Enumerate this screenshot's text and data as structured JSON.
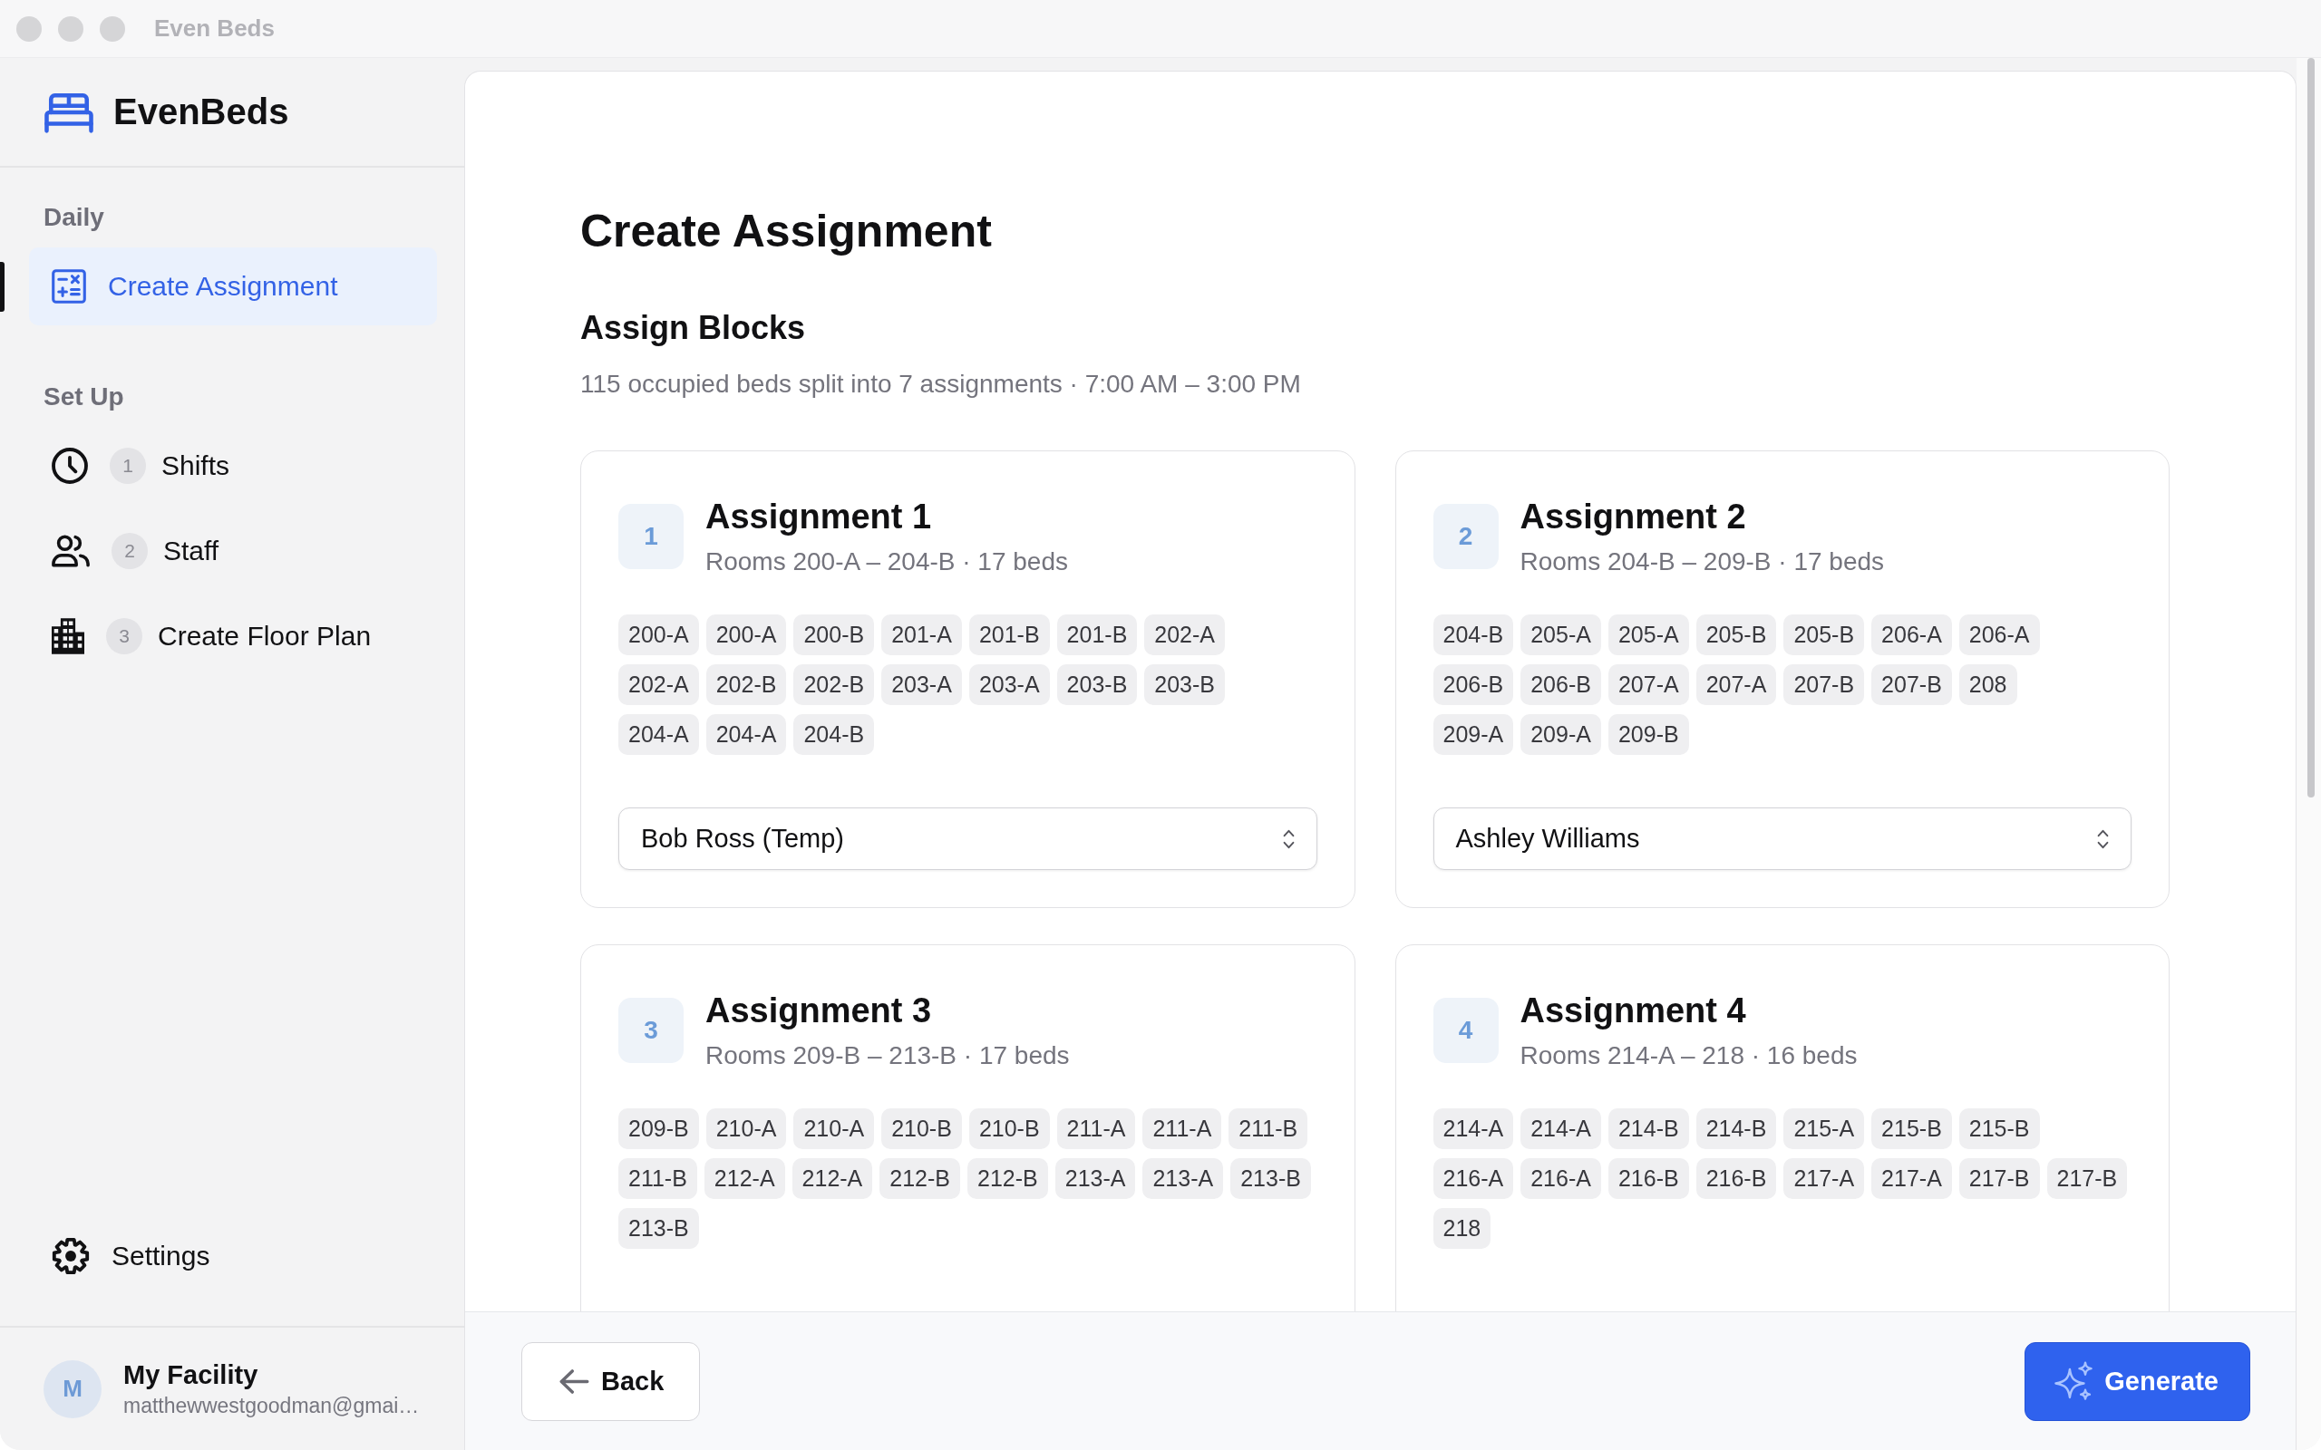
{
  "window": {
    "title": "Even Beds"
  },
  "sidebar": {
    "brand": "EvenBeds",
    "sections": [
      {
        "label": "Daily",
        "items": [
          {
            "label": "Create Assignment",
            "selected": true
          }
        ]
      },
      {
        "label": "Set Up",
        "items": [
          {
            "step": "1",
            "label": "Shifts",
            "selected": false
          },
          {
            "step": "2",
            "label": "Staff",
            "selected": false
          },
          {
            "step": "3",
            "label": "Create Floor Plan",
            "selected": false
          }
        ]
      }
    ],
    "settings": {
      "label": "Settings"
    },
    "account": {
      "avatar": "M",
      "name": "My Facility",
      "email": "matthewwestgoodman@gmai…"
    }
  },
  "page": {
    "title": "Create Assignment",
    "section_title": "Assign Blocks",
    "summary": "115 occupied beds split into 7 assignments · 7:00 AM – 3:00 PM"
  },
  "assignments": [
    {
      "number": "1",
      "title": "Assignment 1",
      "range": "Rooms 200-A – 204-B · 17 beds",
      "bed_rows": [
        [
          "200-A",
          "200-A",
          "200-B",
          "201-A",
          "201-B",
          "201-B",
          "202-A"
        ],
        [
          "202-A",
          "202-B",
          "202-B",
          "203-A",
          "203-A",
          "203-B",
          "203-B"
        ],
        [
          "204-A",
          "204-A",
          "204-B"
        ]
      ],
      "assignee": "Bob Ross (Temp)"
    },
    {
      "number": "2",
      "title": "Assignment 2",
      "range": "Rooms 204-B – 209-B · 17 beds",
      "bed_rows": [
        [
          "204-B",
          "205-A",
          "205-A",
          "205-B",
          "205-B",
          "206-A",
          "206-A"
        ],
        [
          "206-B",
          "206-B",
          "207-A",
          "207-A",
          "207-B",
          "207-B",
          "208"
        ],
        [
          "209-A",
          "209-A",
          "209-B"
        ]
      ],
      "assignee": "Ashley Williams"
    },
    {
      "number": "3",
      "title": "Assignment 3",
      "range": "Rooms 209-B – 213-B · 17 beds",
      "bed_rows": [
        [
          "209-B",
          "210-A",
          "210-A",
          "210-B",
          "210-B",
          "211-A",
          "211-A",
          "211-B"
        ],
        [
          "211-B",
          "212-A",
          "212-A",
          "212-B",
          "212-B",
          "213-A",
          "213-A",
          "213-B"
        ],
        [
          "213-B"
        ]
      ]
    },
    {
      "number": "4",
      "title": "Assignment 4",
      "range": "Rooms 214-A – 218 · 16 beds",
      "bed_rows": [
        [
          "214-A",
          "214-A",
          "214-B",
          "214-B",
          "215-A",
          "215-B",
          "215-B"
        ],
        [
          "216-A",
          "216-A",
          "216-B",
          "216-B",
          "217-A",
          "217-A",
          "217-B",
          "217-B"
        ],
        [
          "218"
        ]
      ]
    }
  ],
  "footer": {
    "back": "Back",
    "generate": "Generate"
  }
}
